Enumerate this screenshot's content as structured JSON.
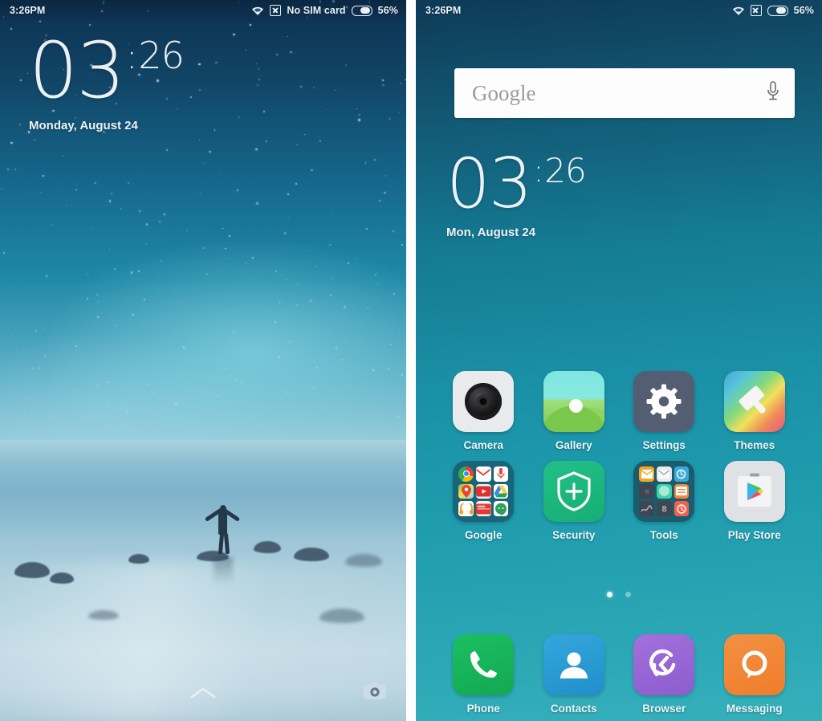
{
  "lockscreen": {
    "status": {
      "time": "3:26PM",
      "wifi_icon": "wifi-icon",
      "sim_icon": "no-sim-icon",
      "sim_text": "No SIM card",
      "battery_icon": "battery-icon",
      "battery_text": "56%"
    },
    "clock": {
      "hours": "03",
      "separator": ":",
      "minutes": "26"
    },
    "date": "Monday, August 24",
    "unlock_hint_icon": "chevron-up-icon",
    "camera_shortcut_icon": "camera-icon"
  },
  "homescreen": {
    "status": {
      "time": "3:26PM",
      "wifi_icon": "wifi-icon",
      "sim_icon": "no-sim-icon",
      "battery_icon": "battery-icon",
      "battery_text": "56%"
    },
    "search": {
      "placeholder": "Google",
      "mic_icon": "microphone-icon"
    },
    "clock": {
      "hours": "03",
      "separator": ":",
      "minutes": "26"
    },
    "date": "Mon, August 24",
    "apps": [
      {
        "label": "Camera",
        "icon": "camera-app-icon"
      },
      {
        "label": "Gallery",
        "icon": "gallery-app-icon"
      },
      {
        "label": "Settings",
        "icon": "settings-app-icon"
      },
      {
        "label": "Themes",
        "icon": "themes-app-icon"
      },
      {
        "label": "Google",
        "icon": "google-folder-icon"
      },
      {
        "label": "Security",
        "icon": "security-app-icon"
      },
      {
        "label": "Tools",
        "icon": "tools-folder-icon"
      },
      {
        "label": "Play Store",
        "icon": "play-store-app-icon"
      }
    ],
    "dock": [
      {
        "label": "Phone",
        "icon": "phone-app-icon"
      },
      {
        "label": "Contacts",
        "icon": "contacts-app-icon"
      },
      {
        "label": "Browser",
        "icon": "browser-app-icon"
      },
      {
        "label": "Messaging",
        "icon": "messaging-app-icon"
      }
    ],
    "page_indicator": {
      "pages": 2,
      "active": 1
    },
    "google_folder_contents": [
      "chrome-icon",
      "gmail-icon",
      "voice-search-icon",
      "maps-icon",
      "youtube-icon",
      "drive-icon",
      "play-music-icon",
      "play-newsstand-icon",
      "hangouts-icon"
    ],
    "tools_folder_contents": [
      "mi-mover-icon",
      "mail-icon",
      "weather-icon",
      "recorder-icon",
      "compass-icon",
      "notes-icon",
      "scanner-icon",
      "calculator-icon",
      "clock-icon"
    ]
  },
  "colors": {
    "accent_teal": "#1f9cae",
    "lock_sky_top": "#0d3050",
    "label_text": "#eaf6fa"
  }
}
